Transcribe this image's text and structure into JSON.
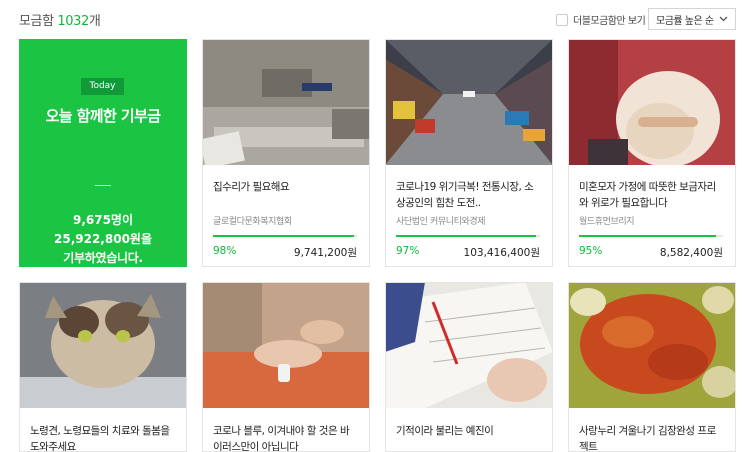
{
  "header": {
    "count_prefix": "모금함",
    "count_number": "1032",
    "count_suffix": "개",
    "double_checkbox_label": "더블모금함만 보기",
    "double_checked": false,
    "sort_label": "모금률 높은 순"
  },
  "today": {
    "badge": "Today",
    "title": "오늘 함께한 기부금",
    "donors": "9,675명이",
    "amount": "25,922,800원을",
    "tail": "기부하였습니다."
  },
  "campaigns": [
    {
      "title": "집수리가 필요해요",
      "org": "글로컬다문화복지협회",
      "percent_text": "98%",
      "progress": 0.98,
      "amount": "9,741,200원",
      "image": "empty-room-photo"
    },
    {
      "title": "코로나19 위기극복! 전통시장, 소상공인의 힘찬 도전..",
      "org": "사단법인 커뮤니티와경제",
      "percent_text": "97%",
      "progress": 0.97,
      "amount": "103,416,400원",
      "image": "market-street-photo"
    },
    {
      "title": "미혼모자 가정에 따뜻한 보금자리와 위로가 필요합니다",
      "org": "월드휴먼브리지",
      "percent_text": "95%",
      "progress": 0.95,
      "amount": "8,582,400원",
      "image": "pregnant-woman-photo"
    },
    {
      "title": "노령견, 노령묘들의 치료와 돌봄을 도와주세요",
      "image": "injured-cat-photo"
    },
    {
      "title": "코로나 블루, 이겨내야 할 것은 바이러스만이 아닙니다",
      "image": "elderly-hands-photo"
    },
    {
      "title": "기적이라 불리는 예진이",
      "image": "child-writing-photo"
    },
    {
      "title": "사랑누리 겨울나기 김장완성 프로젝트",
      "image": "kimchi-photo"
    }
  ]
}
